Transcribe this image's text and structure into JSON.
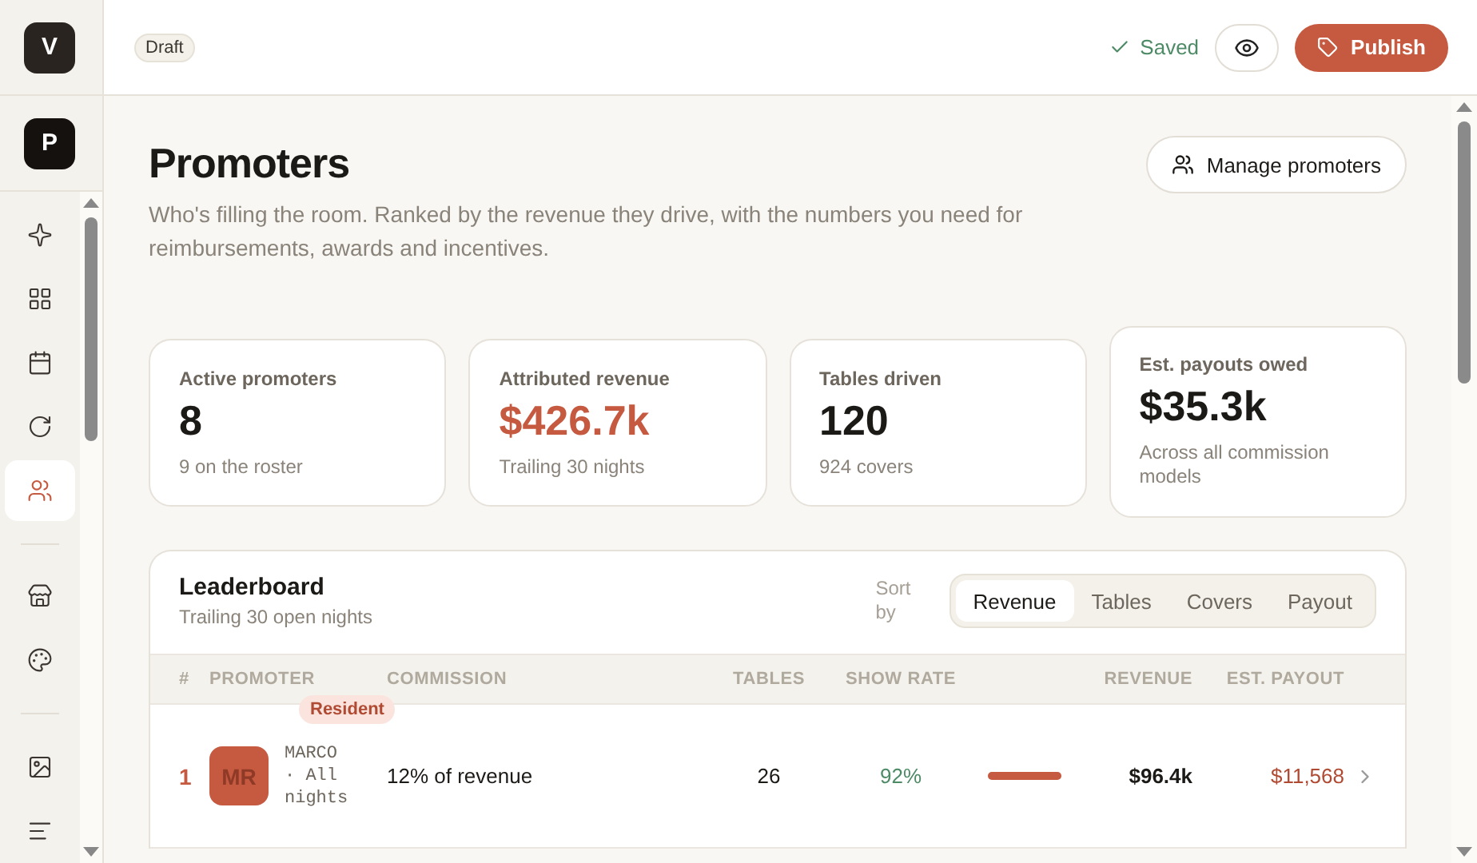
{
  "sidebar": {
    "workspace": "V",
    "project": "P",
    "groups": [
      {
        "items": [
          {
            "selected": false
          },
          {
            "selected": false
          },
          {
            "selected": false
          },
          {
            "selected": false
          },
          {
            "selected": true
          }
        ]
      },
      {
        "items": [
          {
            "selected": false
          },
          {
            "selected": false
          }
        ]
      },
      {
        "items": [
          {
            "selected": false
          },
          {
            "selected": false
          }
        ]
      }
    ]
  },
  "topbar": {
    "status_badge": "Draft",
    "save_state": "Saved",
    "publish_label": "Publish"
  },
  "header": {
    "title": "Promoters",
    "description": "Who's filling the room. Ranked by the revenue they drive, with the numbers you need for reimbursements, awards and incentives.",
    "action": "Manage promoters"
  },
  "stats": [
    {
      "label": "Active promoters",
      "value": "8",
      "note": "9 on the roster",
      "accent": false
    },
    {
      "label": "Attributed revenue",
      "value": "$426.7k",
      "note": "Trailing 30 nights",
      "accent": true
    },
    {
      "label": "Tables driven",
      "value": "120",
      "note": "924 covers",
      "accent": false
    },
    {
      "label": "Est. payouts owed",
      "value": "$35.3k",
      "note": "Across all commission models",
      "accent": false
    }
  ],
  "leaderboard": {
    "title": "Leaderboard",
    "subtitle": "Trailing 30 open nights",
    "sort_label": "Sort by",
    "sort_tabs": [
      {
        "label": "Revenue",
        "selected": true
      },
      {
        "label": "Tables",
        "selected": false
      },
      {
        "label": "Covers",
        "selected": false
      },
      {
        "label": "Payout",
        "selected": false
      }
    ],
    "columns": [
      "#",
      "PROMOTER",
      "COMMISSION",
      "TABLES",
      "SHOW RATE",
      "REVENUE",
      "EST. PAYOUT"
    ],
    "rows": [
      {
        "rank": "1",
        "initials": "MR",
        "badge": "Resident",
        "name": "MARCO · All nights",
        "commission": "12% of revenue",
        "tables": "26",
        "show_rate": "92%",
        "level": 1,
        "revenue": "$96.4k",
        "payout": "$11,568"
      }
    ]
  }
}
